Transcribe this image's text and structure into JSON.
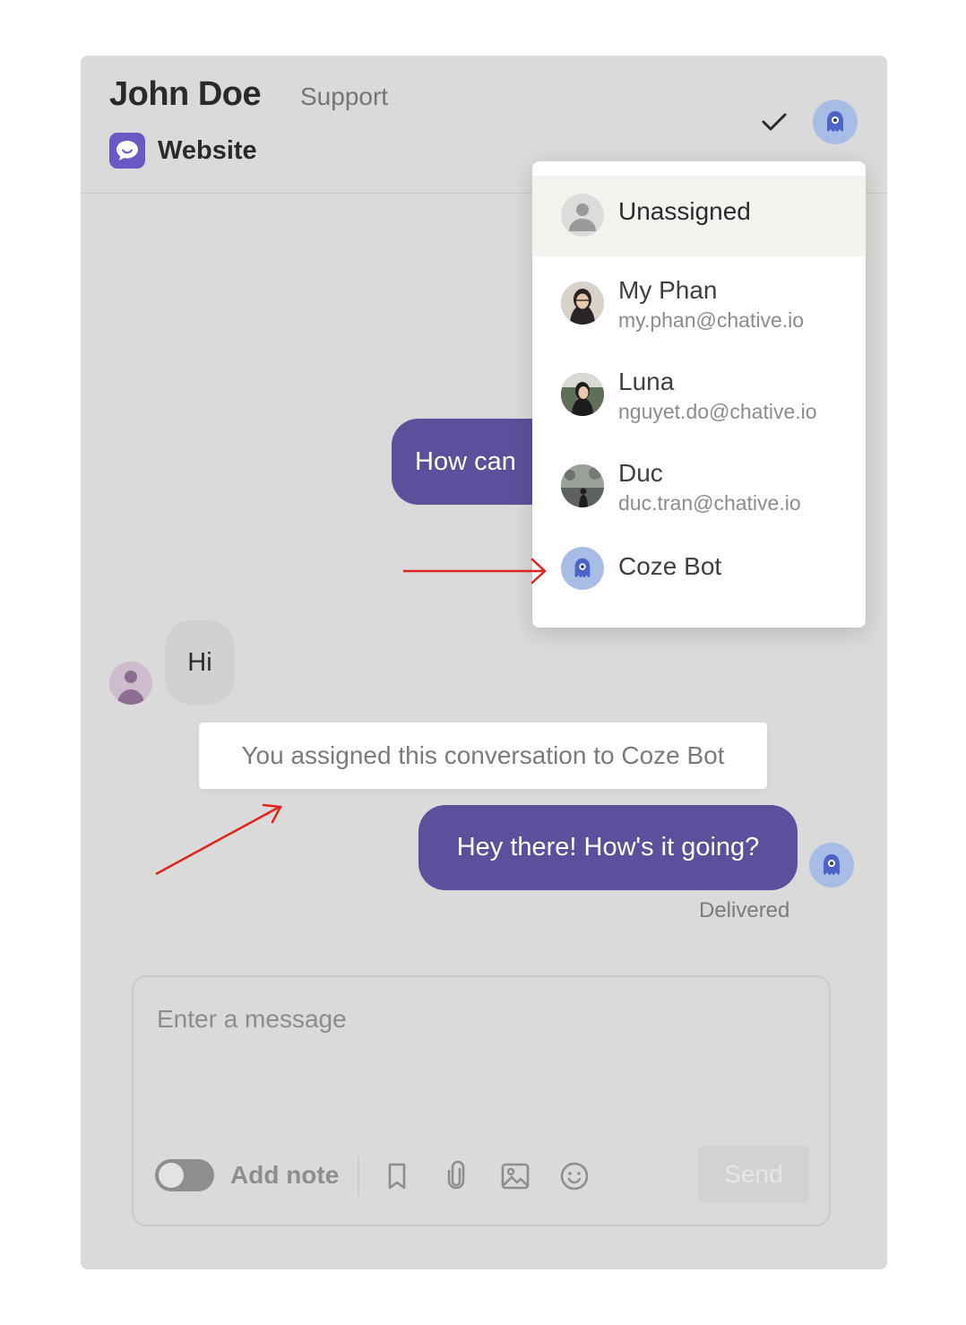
{
  "header": {
    "contact_name": "John Doe",
    "team": "Support",
    "channel": "Website",
    "icons": {
      "channel": "chat-bubble-icon",
      "resolve": "checkmark-icon",
      "assignee": "robot-icon"
    }
  },
  "messages": [
    {
      "direction": "outgoing",
      "text": "How can",
      "partially_hidden": true
    },
    {
      "direction": "incoming",
      "text": "Hi"
    },
    {
      "type": "system",
      "text": "You assigned this conversation to Coze Bot"
    },
    {
      "direction": "outgoing",
      "text": "Hey there! How's it going?",
      "status": "Delivered"
    }
  ],
  "composer": {
    "placeholder": "Enter a message",
    "add_note_label": "Add note",
    "send_label": "Send",
    "tools": [
      "bookmark-icon",
      "paperclip-icon",
      "image-icon",
      "emoji-icon"
    ]
  },
  "assign_dropdown": {
    "items": [
      {
        "name": "Unassigned",
        "email": "",
        "selected": true
      },
      {
        "name": "My Phan",
        "email": "my.phan@chative.io"
      },
      {
        "name": "Luna",
        "email": "nguyet.do@chative.io"
      },
      {
        "name": "Duc",
        "email": "duc.tran@chative.io"
      },
      {
        "name": "Coze Bot",
        "email": ""
      }
    ]
  },
  "colors": {
    "accent": "#5a509c",
    "brand_channel": "#6b58c4",
    "bot_avatar": "#a7bde5",
    "annotation_arrow": "#e0231c"
  }
}
